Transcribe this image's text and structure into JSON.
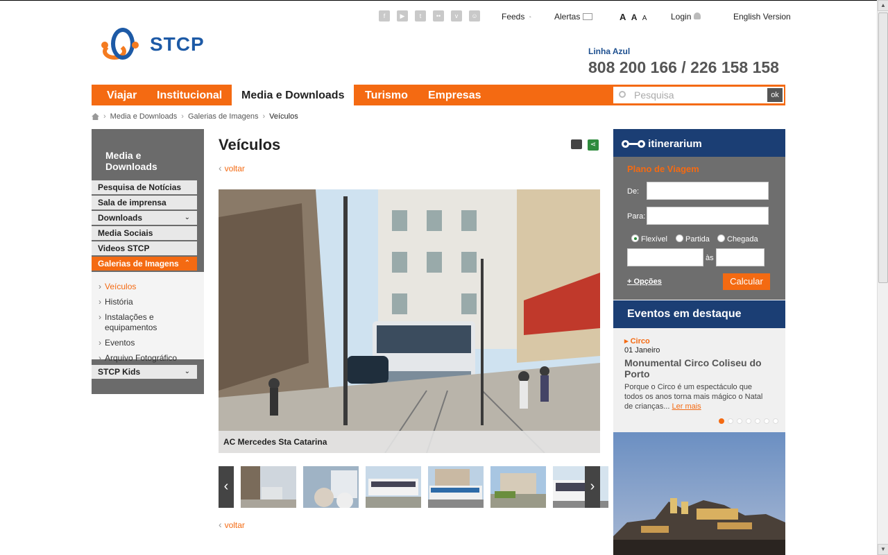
{
  "header": {
    "social_icons": [
      "facebook-icon",
      "youtube-icon",
      "twitter-icon",
      "flickr-icon",
      "vimeo-icon",
      "myspace-icon"
    ],
    "feeds": "Feeds",
    "alertas": "Alertas",
    "font_sizes": [
      "A",
      "A",
      "A"
    ],
    "login": "Login",
    "english": "English Version",
    "logo_text": "STCP",
    "linha_label": "Linha Azul",
    "phone": "808 200 166 / 226 158 158"
  },
  "nav": {
    "items": [
      "Viajar",
      "Institucional",
      "Media e Downloads",
      "Turismo",
      "Empresas"
    ],
    "active": "Media e Downloads",
    "search_placeholder": "Pesquisa",
    "search_button": "ok"
  },
  "breadcrumb": [
    "Media e Downloads",
    "Galerias de Imagens",
    "Veículos"
  ],
  "sidebar": {
    "title": "Media e Downloads",
    "items": [
      {
        "label": "Pesquisa de Notícias"
      },
      {
        "label": "Sala de imprensa"
      },
      {
        "label": "Downloads",
        "chevron": "⌄"
      },
      {
        "label": "Media Sociais"
      },
      {
        "label": "Videos STCP"
      },
      {
        "label": "Galerias de Imagens",
        "chevron": "⌃"
      }
    ],
    "subitems": [
      "Veículos",
      "História",
      "Instalações e equipamentos",
      "Eventos",
      "Arquivo Fotográfico"
    ],
    "kids": {
      "label": "STCP Kids",
      "chevron": "⌄"
    }
  },
  "main": {
    "title": "Veículos",
    "back_label": "voltar",
    "caption": "AC Mercedes Sta Catarina",
    "prev": "‹",
    "next": "›"
  },
  "itinerarium": {
    "logo": "itinerarium",
    "plano": "Plano de Viagem",
    "de": "De:",
    "para": "Para:",
    "radio_flexivel": "Flexível",
    "radio_partida": "Partida",
    "radio_chegada": "Chegada",
    "as": "às",
    "opcoes": "+ Opções",
    "calcular": "Calcular"
  },
  "events": {
    "heading": "Eventos em destaque",
    "category": "Circo",
    "date": "01 Janeiro",
    "title": "Monumental Circo Coliseu do Porto",
    "desc": "Porque o Circo é um espectáculo que todos os anos torna mais mágico o Natal de crianças...",
    "more": "Ler mais",
    "dots": 7
  },
  "colors": {
    "orange": "#f46a12",
    "blue": "#1b3e74",
    "gray": "#6b6b6b"
  }
}
